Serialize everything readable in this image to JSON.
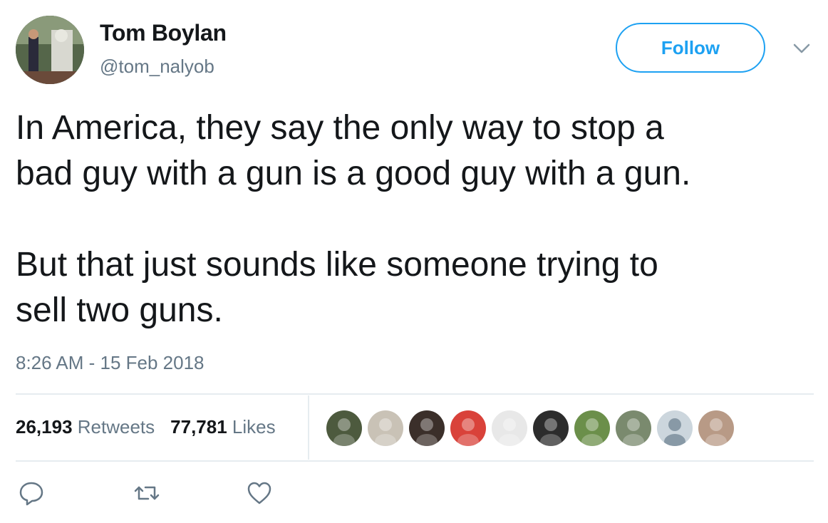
{
  "author": {
    "name": "Tom Boylan",
    "handle": "@tom_nalyob"
  },
  "follow_label": "Follow",
  "tweet": {
    "text": "In America, they say the only way to stop a\nbad guy with a gun is a good guy with a gun.\n\nBut that just sounds like someone trying to\nsell two guns.",
    "timestamp": "8:26 AM - 15 Feb 2018"
  },
  "stats": {
    "retweets_count": "26,193",
    "retweets_label": "Retweets",
    "likes_count": "77,781",
    "likes_label": "Likes"
  },
  "likers": [
    {
      "color": "#4d5a3e"
    },
    {
      "color": "#c9c2b6"
    },
    {
      "color": "#3b2f2a"
    },
    {
      "color": "#d9423a"
    },
    {
      "color": "#e8e8e8"
    },
    {
      "color": "#2c2c2c"
    },
    {
      "color": "#6b8f4a"
    },
    {
      "color": "#7a8a6e"
    },
    {
      "color": "#ccd6dd"
    },
    {
      "color": "#b89a86"
    }
  ],
  "icons": {
    "reply": "reply-icon",
    "retweet": "retweet-icon",
    "like": "heart-icon",
    "more": "chevron-down-icon"
  },
  "colors": {
    "accent": "#1da1f2",
    "text": "#14171a",
    "secondary": "#657786",
    "divider": "#e6ecf0"
  }
}
